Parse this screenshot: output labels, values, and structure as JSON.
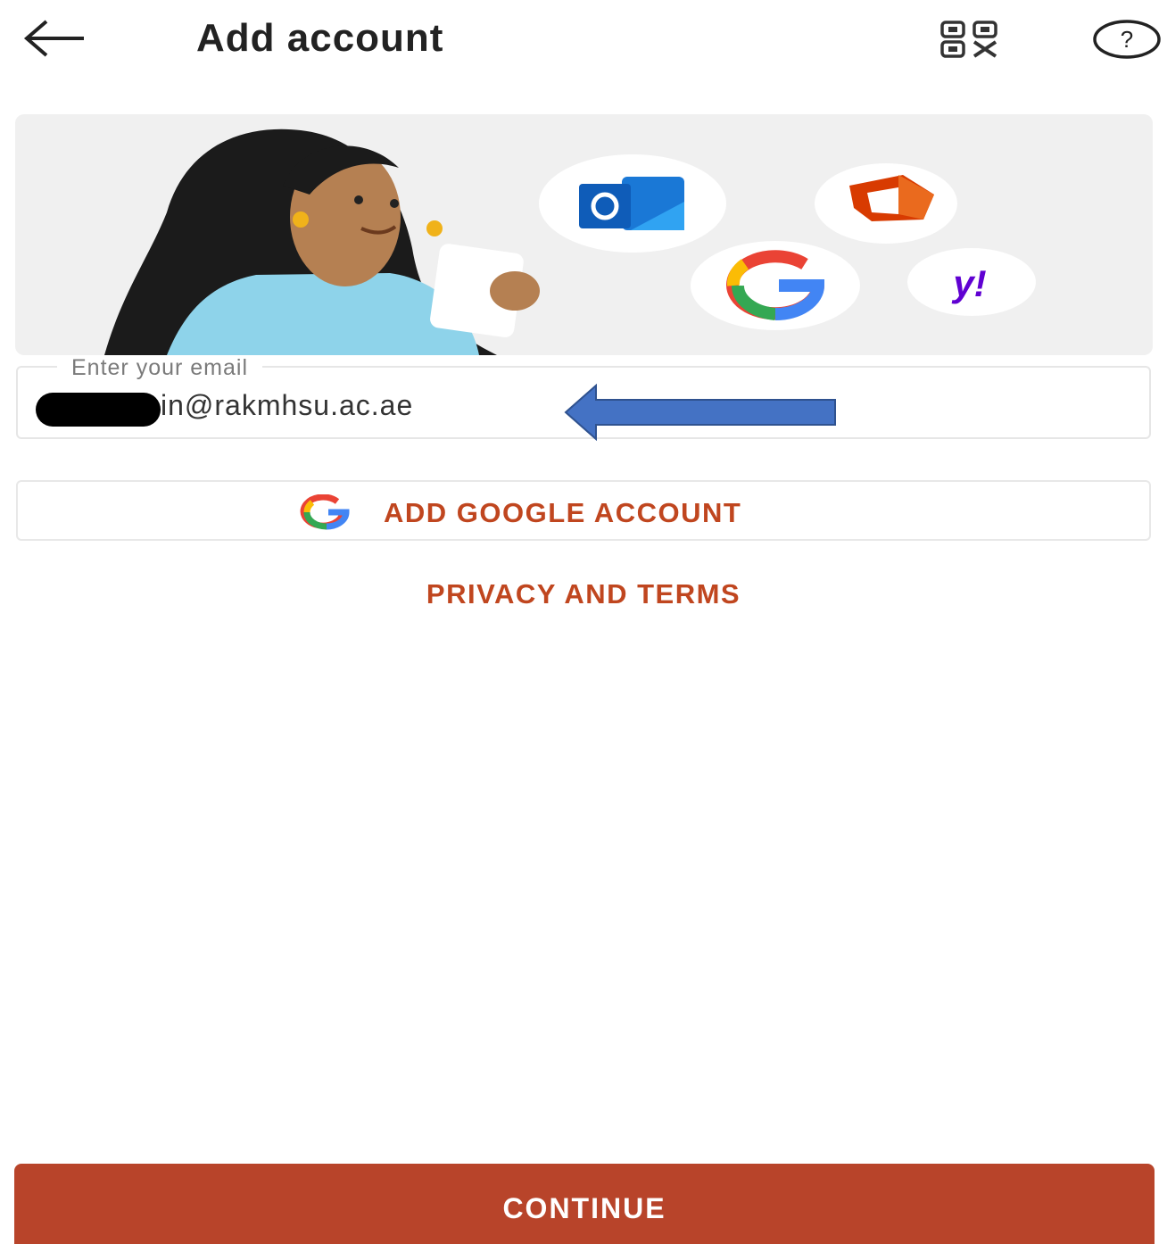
{
  "header": {
    "title": "Add account",
    "back_icon": "arrow-left-icon",
    "qr_icon": "qr-code-icon",
    "help_icon": "help-circle-icon"
  },
  "hero": {
    "provider_icons": [
      "outlook-icon",
      "office-icon",
      "google-icon",
      "yahoo-icon"
    ]
  },
  "email": {
    "label": "Enter your email",
    "value": "in@rakmhsu.ac.ae",
    "redacted": true
  },
  "google_button": {
    "label": "ADD GOOGLE ACCOUNT",
    "icon": "google-icon"
  },
  "privacy_link": "PRIVACY AND TERMS",
  "continue_button": "CONTINUE",
  "colors": {
    "accent": "#c0461f",
    "continue_bg": "#b8442a",
    "annotation_arrow": "#4472c4"
  }
}
